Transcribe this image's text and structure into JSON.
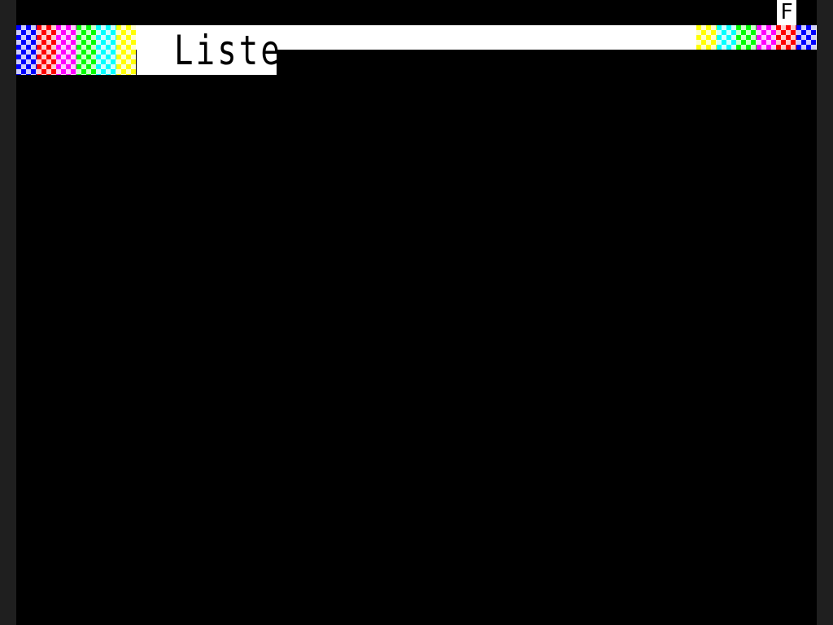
{
  "screen": {
    "title": "Liste",
    "indicator": "F"
  },
  "palette": {
    "background": "#000000",
    "bar": "#ffffff",
    "left_blocks": [
      "#0000ff",
      "#ff0000",
      "#ff00ff",
      "#00ff00",
      "#00ffff",
      "#ffff00"
    ],
    "right_blocks": [
      "#ffff00",
      "#00ffff",
      "#00ff00",
      "#ff00ff",
      "#ff0000",
      "#0000ff"
    ]
  }
}
